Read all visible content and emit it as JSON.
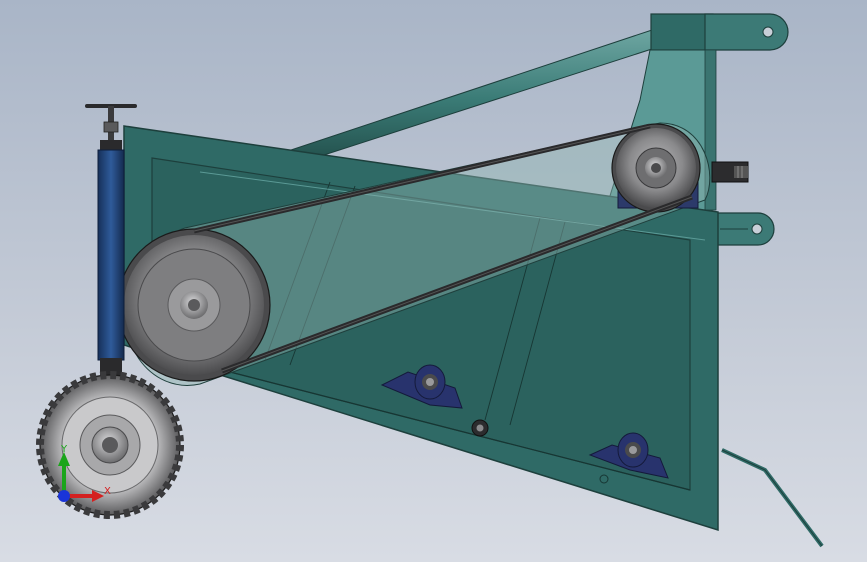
{
  "viewport": {
    "background_top": "#a9b5c7",
    "background_bottom": "#d8dce4"
  },
  "colors": {
    "frame_teal": "#2f6a66",
    "frame_teal_light": "#5b9a96",
    "frame_edge": "#1d3f3c",
    "belt_guard": "#7f9ea0",
    "pulley_gray": "#8e8e90",
    "pulley_dark": "#4a4a4c",
    "cylinder_blue": "#1e3f70",
    "bearing_navy": "#28336d",
    "tire_dark": "#3a3a3c"
  },
  "icons": {
    "handwheel": "jack-handwheel-icon",
    "triad": "coordinate-triad-icon"
  },
  "triad": {
    "x_label": "X",
    "y_label": "Y",
    "x_color": "#d42020",
    "y_color": "#1aa51a",
    "z_color": "#1a34d8"
  }
}
